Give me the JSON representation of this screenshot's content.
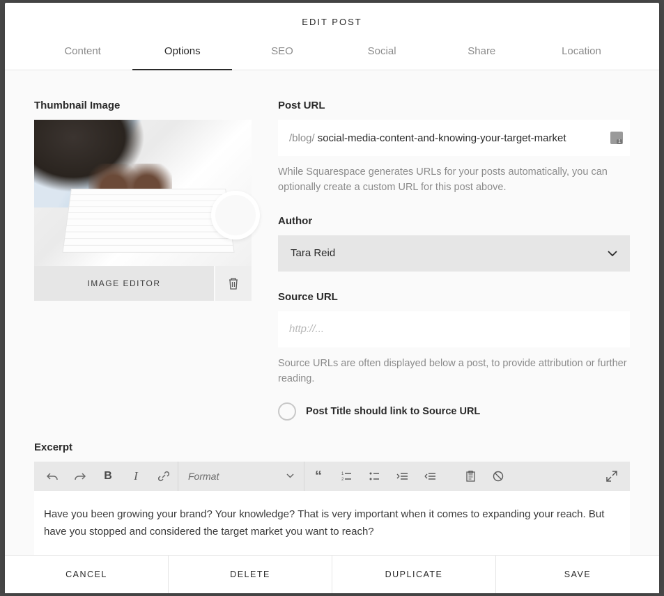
{
  "header": {
    "title": "EDIT POST"
  },
  "tabs": [
    {
      "label": "Content",
      "active": false
    },
    {
      "label": "Options",
      "active": true
    },
    {
      "label": "SEO",
      "active": false
    },
    {
      "label": "Social",
      "active": false
    },
    {
      "label": "Share",
      "active": false
    },
    {
      "label": "Location",
      "active": false
    }
  ],
  "thumbnail": {
    "label": "Thumbnail Image",
    "editor_button": "IMAGE EDITOR"
  },
  "post_url": {
    "label": "Post URL",
    "prefix": "/blog/",
    "value": "social-media-content-and-knowing-your-target-market",
    "help": "While Squarespace generates URLs for your posts automatically, you can optionally create a custom URL for this post above."
  },
  "author": {
    "label": "Author",
    "selected": "Tara Reid"
  },
  "source_url": {
    "label": "Source URL",
    "placeholder": "http://...",
    "value": "",
    "help": "Source URLs are often displayed below a post, to provide attribution or further reading.",
    "link_title_toggle_label": "Post Title should link to Source URL"
  },
  "excerpt": {
    "label": "Excerpt",
    "format_label": "Format",
    "body": "Have you been growing your brand? Your knowledge? That is very important when it comes to expanding your reach. But have you stopped and considered the target market you want to reach?"
  },
  "footer": {
    "cancel": "CANCEL",
    "delete": "DELETE",
    "duplicate": "DUPLICATE",
    "save": "SAVE"
  }
}
